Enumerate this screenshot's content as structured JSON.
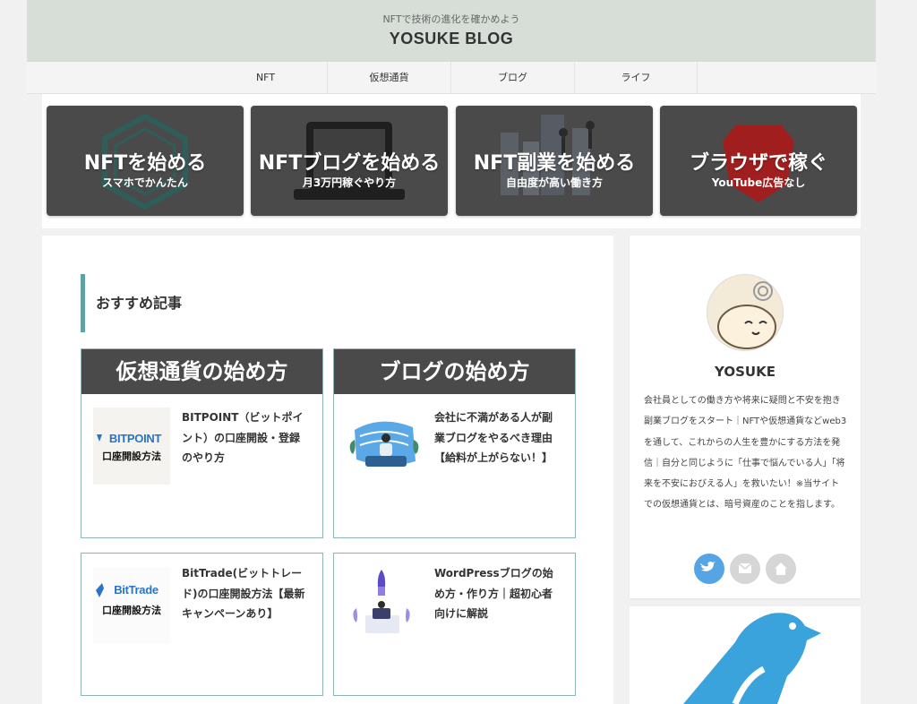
{
  "header": {
    "tagline": "NFTで技術の進化を確かめよう",
    "title": "YOSUKE BLOG"
  },
  "nav": {
    "items": [
      "NFT",
      "仮想通貨",
      "ブログ",
      "ライフ"
    ]
  },
  "banners": [
    {
      "main": "NFTを始める",
      "sub": "スマホでかんたん"
    },
    {
      "main": "NFTブログを始める",
      "sub": "月3万円稼ぐやり方"
    },
    {
      "main": "NFT副業を始める",
      "sub": "自由度が高い働き方"
    },
    {
      "main": "ブラウザで稼ぐ",
      "sub": "YouTube広告なし"
    }
  ],
  "recommended": {
    "heading": "おすすめ記事",
    "cards": [
      {
        "caption": "仮想通貨の始め方",
        "thumb_logo": "BITPOINT",
        "thumb_sub": "口座開設方法",
        "title": "BITPOINT（ビットポイント）の口座開設・登録のやり方"
      },
      {
        "caption": "ブログの始め方",
        "title": "会社に不満がある人が副業ブログをやるべき理由【給料が上がらない！】"
      },
      {
        "thumb_logo": "BitTrade",
        "thumb_sub": "口座開設方法",
        "title": "BitTrade(ビットトレード)の口座開設方法【最新キャンペーンあり】"
      },
      {
        "title": "WordPressブログの始め方・作り方｜超初心者向けに解説"
      }
    ]
  },
  "profile": {
    "name": "YOSUKE",
    "bio": "会社員としての働き方や将来に疑問と不安を抱き副業ブログをスタート｜NFTや仮想通貨などweb3を通して、これからの人生を豊かにする方法を発信｜自分と同じように「仕事で悩んでいる人」「将来を不安におびえる人」を救いたい！※当サイトでの仮想通貨とは、暗号資産のことを指します。",
    "social_icons": [
      "twitter-icon",
      "mail-icon",
      "home-icon"
    ]
  },
  "colors": {
    "header_bg": "#d7ded8",
    "accent": "#5fa1a5",
    "banner_bg": "#4a4a4a",
    "twitter": "#55a4e4",
    "bird": "#3ba3dc"
  }
}
